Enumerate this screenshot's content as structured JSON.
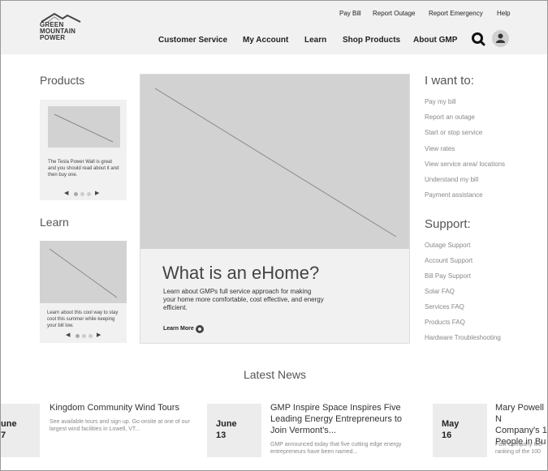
{
  "header": {
    "logo_text": "GREEN\nMOUNTAIN\nPOWER",
    "utility_links": [
      "Pay Bill",
      "Report Outage",
      "Report Emergency",
      "Help"
    ],
    "main_nav": [
      "Customer Service",
      "My Account",
      "Learn",
      "Shop Products",
      "About GMP"
    ],
    "search_icon": "search-icon",
    "user_icon": "user-icon"
  },
  "products": {
    "title": "Products",
    "card_text": "The Tesla Power Wall is great and you should read about it and then buy one."
  },
  "learn": {
    "title": "Learn",
    "card_text": "Learn about this cool way to stay cool this summer while keeping your bill low."
  },
  "hero": {
    "title": "What is an eHome?",
    "description": "Learn about GMPs full service approach for making your home more comfortable, cost effective, and energy efficient.",
    "link": "Learn More"
  },
  "i_want_to": {
    "title": "I want to:",
    "links": [
      "Pay my bill",
      "Report an outage",
      "Start or stop service",
      "View rates",
      "View service area/ locations",
      "Understand my bill",
      "Payment assistance"
    ]
  },
  "support": {
    "title": "Support:",
    "links": [
      "Outage Support",
      "Account Support",
      "Bill Pay Support",
      "Solar FAQ",
      "Services FAQ",
      "Products FAQ",
      "Hardware Troubleshooting"
    ]
  },
  "latest_news": {
    "title": "Latest News",
    "items": [
      {
        "date": "une\n7",
        "headline": "Kingdom Community Wind Tours",
        "summary": "See available tours and sign up. Go onsite at one of our largest wind facilities in Lowell, VT..."
      },
      {
        "date": "June\n13",
        "headline": "GMP Inspire Space Inspires Five Leading Energy Entrepreneurs to Join Vermont's...",
        "summary": "GMP announced today that five cutting edge energy entrepreneurs have been named..."
      },
      {
        "date": "May\n16",
        "headline": "Mary Powell N\nCompany's 1\nPeople in Bu",
        "summary": "Fast Company tod\nranking of the 100"
      }
    ]
  }
}
